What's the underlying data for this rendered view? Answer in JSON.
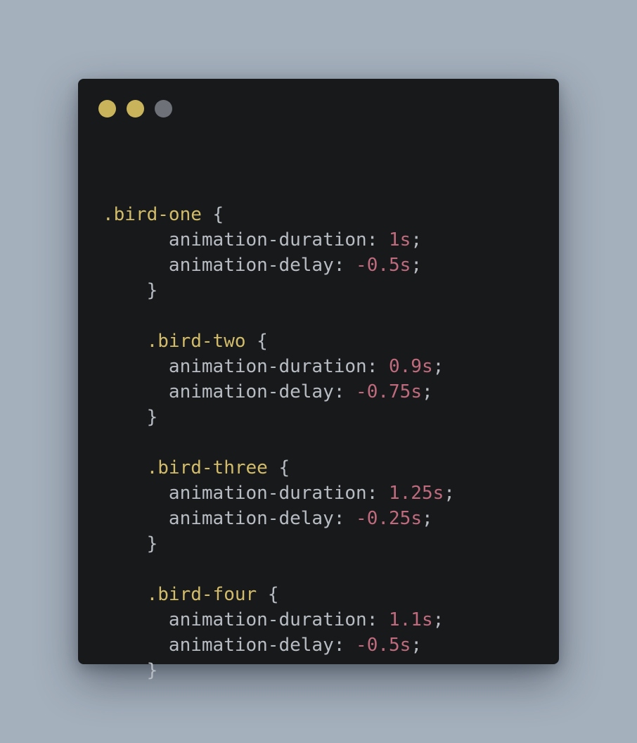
{
  "window": {
    "background": "#18191b",
    "dots": [
      {
        "name": "window-dot-1",
        "color": "#c9b45c"
      },
      {
        "name": "window-dot-2",
        "color": "#c9b45c"
      },
      {
        "name": "window-dot-3",
        "color": "#6e7178"
      }
    ]
  },
  "colors": {
    "page_background": "#a5b0bd",
    "selector": "#d2bc6a",
    "property": "#b8bcc3",
    "number": "#bf6b7d"
  },
  "code": {
    "blocks": [
      {
        "selector": ".bird-one",
        "open_brace": " {",
        "duration_prop": "animation-duration",
        "duration_value": "1s",
        "delay_prop": "animation-delay",
        "delay_value": "-0.5s",
        "close_brace": "}"
      },
      {
        "selector": ".bird-two",
        "open_brace": " {",
        "duration_prop": "animation-duration",
        "duration_value": "0.9s",
        "delay_prop": "animation-delay",
        "delay_value": "-0.75s",
        "close_brace": "}"
      },
      {
        "selector": ".bird-three",
        "open_brace": " {",
        "duration_prop": "animation-duration",
        "duration_value": "1.25s",
        "delay_prop": "animation-delay",
        "delay_value": "-0.25s",
        "close_brace": "}"
      },
      {
        "selector": ".bird-four",
        "open_brace": " {",
        "duration_prop": "animation-duration",
        "duration_value": "1.1s",
        "delay_prop": "animation-delay",
        "delay_value": "-0.5s",
        "close_brace": "}"
      }
    ],
    "colon": ": ",
    "semicolon": ";"
  }
}
